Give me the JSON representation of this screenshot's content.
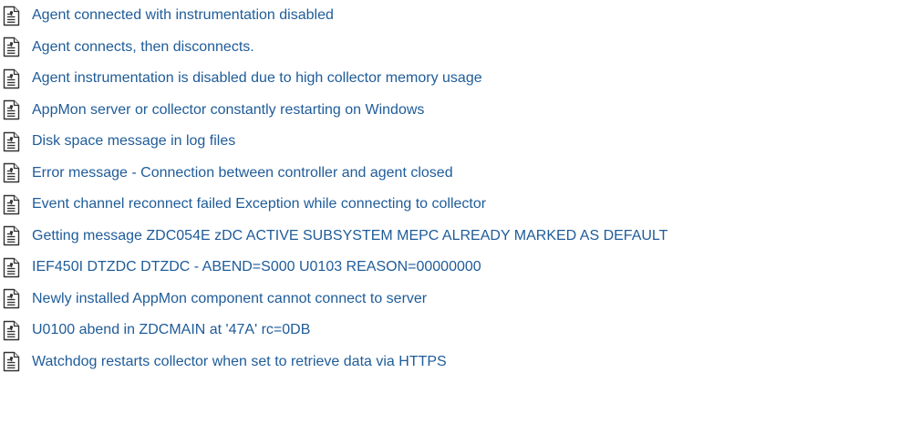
{
  "colors": {
    "link": "#1f5c99",
    "icon_stroke": "#333333",
    "background": "#ffffff"
  },
  "list": {
    "icon": "document-page-icon",
    "items": [
      {
        "label": "Agent connected with instrumentation disabled"
      },
      {
        "label": "Agent connects, then disconnects."
      },
      {
        "label": "Agent instrumentation is disabled due to high collector memory usage"
      },
      {
        "label": "AppMon server or collector constantly restarting on Windows"
      },
      {
        "label": "Disk space message in log files"
      },
      {
        "label": "Error message - Connection between controller and agent closed"
      },
      {
        "label": "Event channel reconnect failed Exception while connecting to collector"
      },
      {
        "label": "Getting message ZDC054E zDC ACTIVE SUBSYSTEM MEPC ALREADY MARKED AS DEFAULT"
      },
      {
        "label": "IEF450I DTZDC DTZDC - ABEND=S000 U0103 REASON=00000000"
      },
      {
        "label": "Newly installed AppMon component cannot connect to server"
      },
      {
        "label": "U0100 abend in ZDCMAIN at '47A' rc=0DB"
      },
      {
        "label": "Watchdog restarts collector when set to retrieve data via HTTPS"
      }
    ]
  }
}
